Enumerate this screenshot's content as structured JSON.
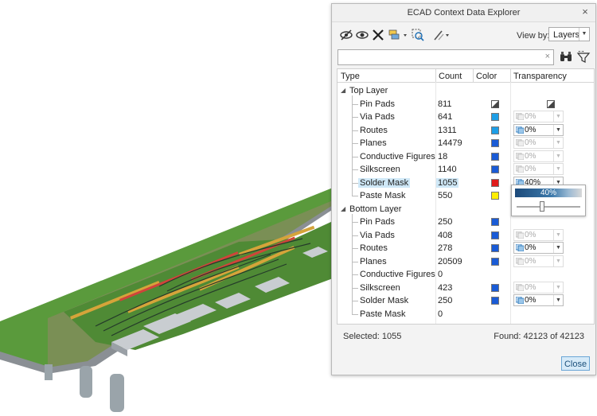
{
  "dialog": {
    "title": "ECAD Context Data Explorer",
    "close_x": "×",
    "view_by_label": "View by:",
    "view_by_value": "Layers",
    "search_clear": "×",
    "status_selected": "Selected: 1055",
    "status_found": "Found: 42123 of 42123",
    "close_button": "Close"
  },
  "columns": {
    "type": "Type",
    "count": "Count",
    "color": "Color",
    "transparency": "Transparency"
  },
  "top_layer": {
    "label": "Top Layer",
    "rows": [
      {
        "name": "Pin Pads",
        "count": "811",
        "color": "#ffffff",
        "trans": ""
      },
      {
        "name": "Via Pads",
        "count": "641",
        "color": "#1e9ee6",
        "trans": "0%"
      },
      {
        "name": "Routes",
        "count": "1311",
        "color": "#1e9ee6",
        "trans": "0%"
      },
      {
        "name": "Planes",
        "count": "14479",
        "color": "#1a5bd6",
        "trans": "0%"
      },
      {
        "name": "Conductive Figures",
        "count": "18",
        "color": "#1a5bd6",
        "trans": "0%"
      },
      {
        "name": "Silkscreen",
        "count": "1140",
        "color": "#1a5bd6",
        "trans": "0%"
      },
      {
        "name": "Solder Mask",
        "count": "1055",
        "color": "#e01b1b",
        "trans": "40%"
      },
      {
        "name": "Paste Mask",
        "count": "550",
        "color": "#ffee00",
        "trans": ""
      }
    ]
  },
  "bottom_layer": {
    "label": "Bottom Layer",
    "rows": [
      {
        "name": "Pin Pads",
        "count": "250",
        "color": "#1a5bd6",
        "trans": ""
      },
      {
        "name": "Via Pads",
        "count": "408",
        "color": "#1a5bd6",
        "trans": "0%"
      },
      {
        "name": "Routes",
        "count": "278",
        "color": "#1a5bd6",
        "trans": "0%"
      },
      {
        "name": "Planes",
        "count": "20509",
        "color": "#1a5bd6",
        "trans": "0%"
      },
      {
        "name": "Conductive Figures",
        "count": "0",
        "color": "",
        "trans": ""
      },
      {
        "name": "Silkscreen",
        "count": "423",
        "color": "#1a5bd6",
        "trans": "0%"
      },
      {
        "name": "Solder Mask",
        "count": "250",
        "color": "#1a5bd6",
        "trans": "0%"
      },
      {
        "name": "Paste Mask",
        "count": "0",
        "color": "",
        "trans": ""
      }
    ]
  },
  "popup": {
    "value": "40%",
    "fraction": 0.4
  },
  "colors": {
    "board_green": "#5b9a3a",
    "copper_pad": "#d2a436",
    "accent_blue": "#1a5bd6"
  }
}
